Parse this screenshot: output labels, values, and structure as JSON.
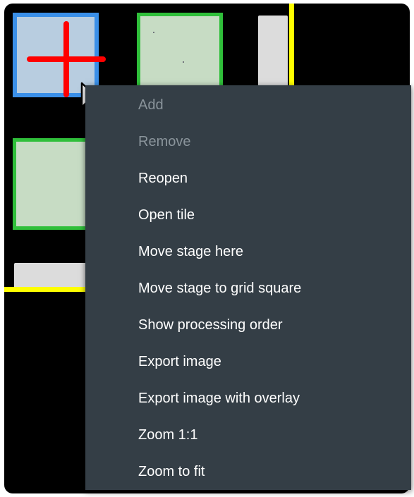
{
  "context_menu": {
    "items": [
      {
        "label": "Add",
        "enabled": false
      },
      {
        "label": "Remove",
        "enabled": false
      },
      {
        "label": "Reopen",
        "enabled": true
      },
      {
        "label": "Open tile",
        "enabled": true
      },
      {
        "label": "Move stage here",
        "enabled": true
      },
      {
        "label": "Move stage to grid square",
        "enabled": true
      },
      {
        "label": "Show processing order",
        "enabled": true
      },
      {
        "label": "Export image",
        "enabled": true
      },
      {
        "label": "Export image with overlay",
        "enabled": true
      },
      {
        "label": "Zoom 1:1",
        "enabled": true
      },
      {
        "label": "Zoom to fit",
        "enabled": true
      }
    ]
  },
  "colors": {
    "viewport_background": "#000000",
    "menu_background": "#343e46",
    "menu_text": "#ffffff",
    "menu_text_disabled": "#8a949b",
    "selected_tile_border": "#3a8fe8",
    "selected_tile_fill": "#b8cde0",
    "green_tile_border": "#2fbf3a",
    "green_tile_fill": "#c7dcc4",
    "crosshair": "#ff0000",
    "boundary_line": "#ffff00"
  },
  "icons": {
    "crosshair": "crosshair-icon",
    "cursor": "mouse-pointer-icon"
  }
}
